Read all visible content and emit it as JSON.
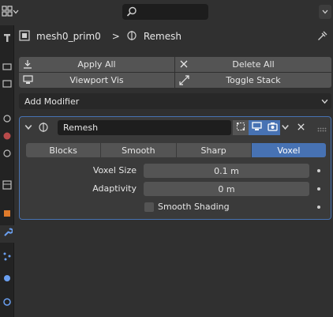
{
  "header": {
    "search_placeholder": ""
  },
  "breadcrumb": {
    "object": "mesh0_prim0",
    "separator": ">",
    "modifier": "Remesh"
  },
  "toolbar": {
    "apply_all": "Apply All",
    "delete_all": "Delete All",
    "viewport_vis": "Viewport Vis",
    "toggle_stack": "Toggle Stack"
  },
  "add_modifier": "Add Modifier",
  "modifier": {
    "name": "Remesh",
    "modes": [
      "Blocks",
      "Smooth",
      "Sharp",
      "Voxel"
    ],
    "selected_mode": "Voxel",
    "voxel_size_label": "Voxel Size",
    "voxel_size_value": "0.1 m",
    "adaptivity_label": "Adaptivity",
    "adaptivity_value": "0 m",
    "smooth_shading_label": "Smooth Shading",
    "smooth_shading_checked": false
  },
  "colors": {
    "accent": "#4772b3",
    "panel": "#3a3a3a",
    "button": "#545454",
    "background": "#303030"
  },
  "icons": [
    "editor-type-icon",
    "search-icon",
    "chevron-down-icon",
    "mesh-icon",
    "modifier-icon",
    "pin-icon",
    "apply-icon",
    "close-icon",
    "monitor-icon",
    "expand-icon",
    "edit-mode-icon",
    "realtime-icon",
    "render-icon",
    "drag-handle-icon",
    "wrench-icon"
  ]
}
